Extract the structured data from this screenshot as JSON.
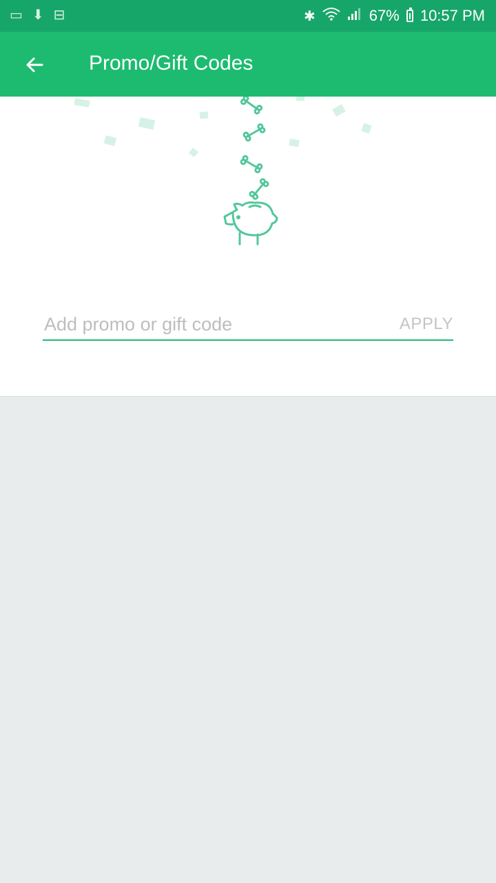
{
  "status_bar": {
    "battery": "67%",
    "time": "10:57 PM",
    "icons": [
      "image-icon",
      "notification-icon",
      "inbox-icon",
      "bluetooth-icon",
      "wifi-icon",
      "signal-icon",
      "battery-icon"
    ]
  },
  "app_bar": {
    "title": "Promo/Gift Codes",
    "back_icon": "arrow-left-icon"
  },
  "illustration": {
    "name": "piggy-bank-with-falling-bones",
    "accent": "#52c79b"
  },
  "promo": {
    "placeholder": "Add promo or gift code",
    "value": "",
    "apply_label": "APPLY"
  },
  "colors": {
    "status_bar": "#17a669",
    "app_bar": "#1dbb6f",
    "background": "#e8ecec",
    "underline": "#1dbb6f"
  }
}
